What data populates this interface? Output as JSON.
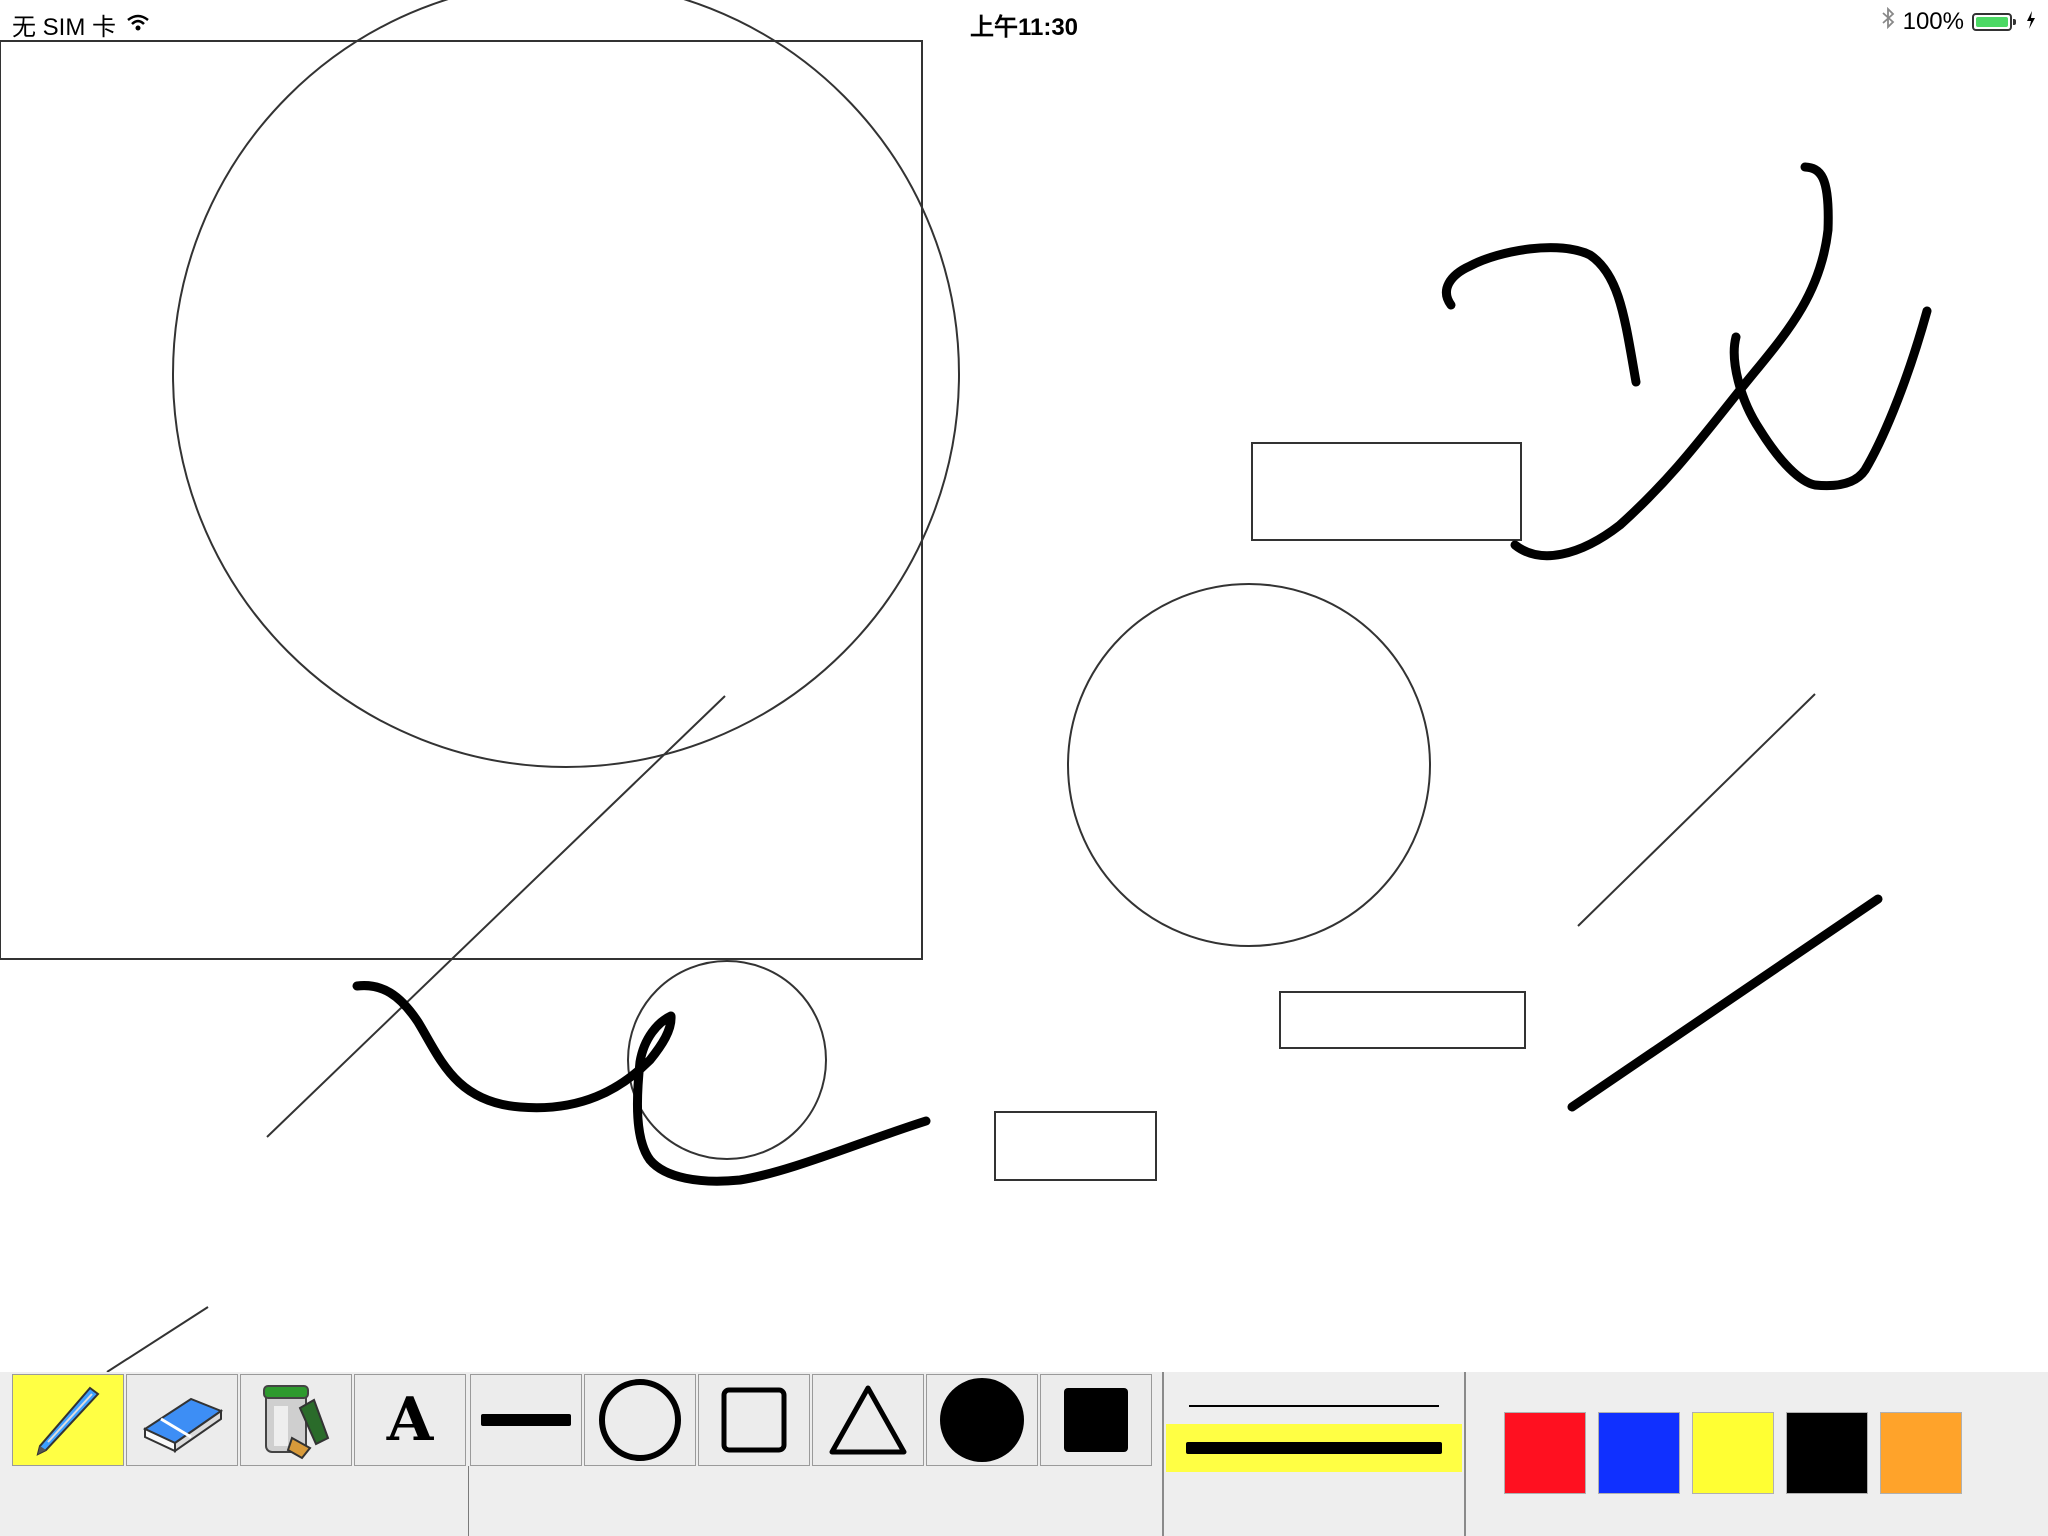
{
  "status_bar": {
    "carrier": "无 SIM 卡",
    "time": "上午11:30",
    "battery_percent": "100%",
    "battery_level": 1.0,
    "battery_color": "#4cd964",
    "icons": [
      "wifi-icon",
      "bluetooth-icon",
      "battery-icon",
      "charging-bolt-icon"
    ]
  },
  "canvas": {
    "background": "#ffffff",
    "stroke_color": "#000000"
  },
  "toolbar": {
    "background": "#eeeeee",
    "active_highlight": "#ffff44",
    "tools": [
      {
        "name": "pencil",
        "icon": "pencil-icon",
        "active": true
      },
      {
        "name": "eraser",
        "icon": "eraser-icon",
        "active": false
      },
      {
        "name": "paint-bucket",
        "icon": "paint-bucket-icon",
        "active": false
      },
      {
        "name": "text",
        "icon": "text-tool-icon",
        "label": "A",
        "active": false
      },
      {
        "name": "line",
        "icon": "line-tool-icon",
        "active": false
      },
      {
        "name": "circle",
        "icon": "circle-tool-icon",
        "active": false
      },
      {
        "name": "rectangle",
        "icon": "rectangle-tool-icon",
        "active": false
      },
      {
        "name": "triangle",
        "icon": "triangle-tool-icon",
        "active": false
      },
      {
        "name": "filled-circle",
        "icon": "filled-circle-tool-icon",
        "active": false
      },
      {
        "name": "filled-square",
        "icon": "filled-square-tool-icon",
        "active": false
      }
    ],
    "line_widths": [
      {
        "name": "thin",
        "selected": false
      },
      {
        "name": "thick",
        "selected": true
      }
    ],
    "colors": [
      "#ff1020",
      "#1030ff",
      "#ffff33",
      "#000000",
      "#ffa32a"
    ],
    "selected_color": "#000000"
  }
}
